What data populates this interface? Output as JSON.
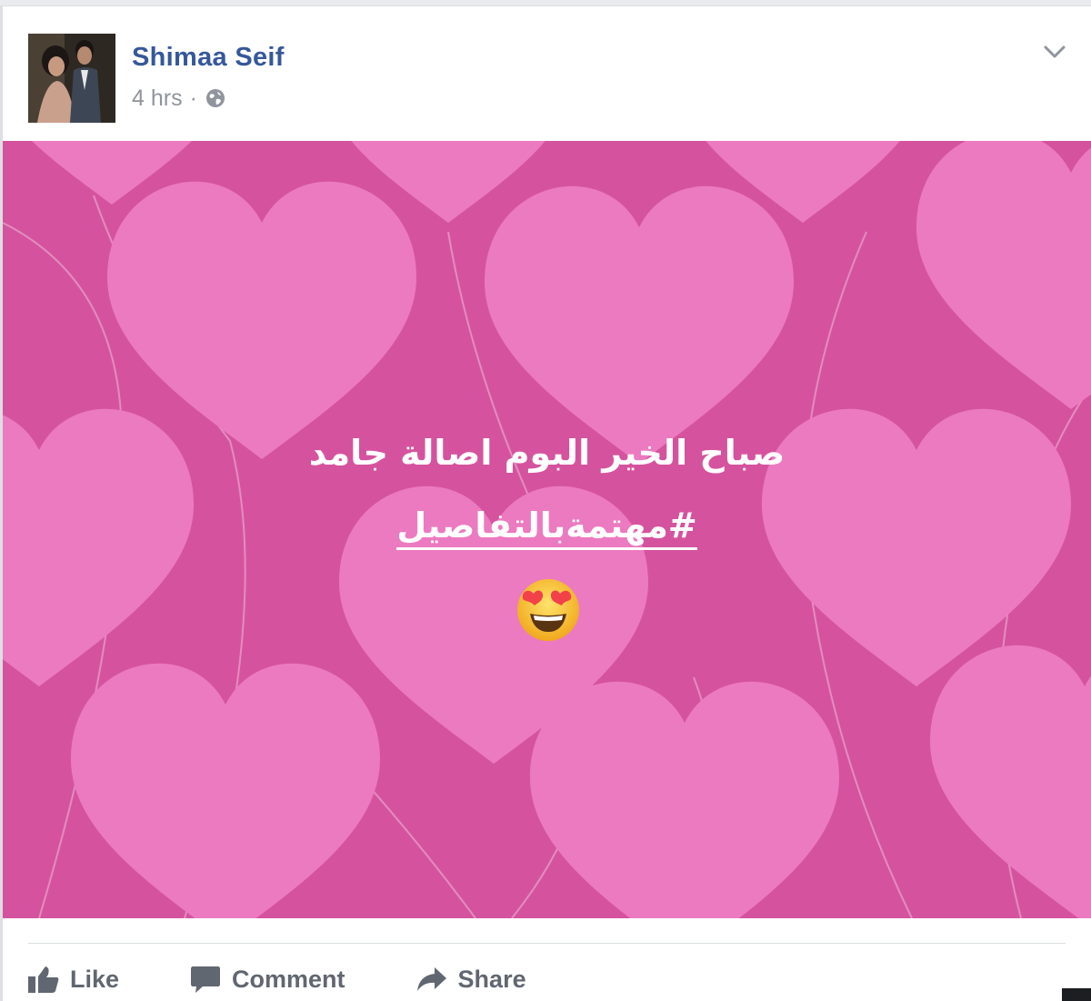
{
  "post": {
    "author": "Shimaa Seif",
    "timestamp": "4 hrs",
    "separator": "·",
    "privacy_icon": "globe-icon",
    "menu_icon": "chevron-down-icon",
    "background_color": "#d5539e",
    "heart_color": "#ec7ac0",
    "status_text": "صباح الخير البوم اصالة جامد",
    "hashtag": "#مهتمةبالتفاصيل",
    "emoji": "smiling-face-with-heart-eyes"
  },
  "actions": {
    "like": "Like",
    "comment": "Comment",
    "share": "Share"
  },
  "colors": {
    "author_link": "#365899",
    "meta_text": "#90949c",
    "action_text": "#616770"
  }
}
